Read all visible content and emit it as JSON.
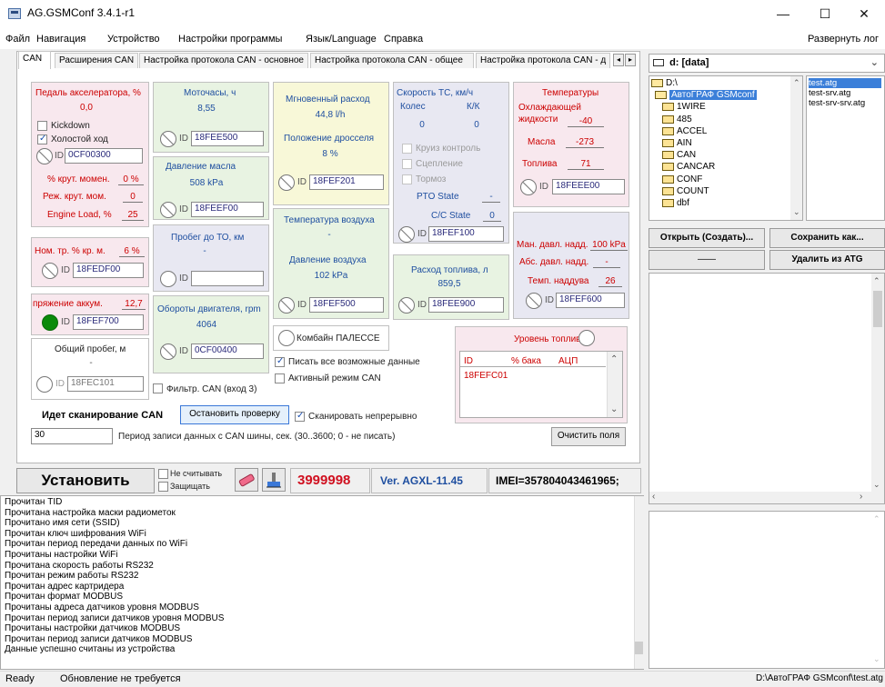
{
  "window": {
    "title": "AG.GSMConf 3.4.1-r1",
    "minimize": "—",
    "maximize": "☐",
    "close": "✕"
  },
  "menu": {
    "items": [
      "Файл",
      "Навигация",
      "Устройство",
      "Настройки программы",
      "Язык/Language",
      "Справка"
    ],
    "expand_log": "Развернуть лог"
  },
  "tabs": [
    "CAN",
    "Расширения CAN",
    "Настройка протокола CAN - основное",
    "Настройка протокола CAN - общее",
    "Настройка протокола CAN - д"
  ],
  "tab_scroll": {
    "left": "◂",
    "right": "▸"
  },
  "can": {
    "accel": {
      "label": "Педаль акселератора, %",
      "value": "0,0"
    },
    "kickdown": "Kickdown",
    "idle": "Холостой ход",
    "id_label": "ID",
    "pedal_id": "0CF00300",
    "torque_pct": {
      "label": "% крут. момен.",
      "value": "0 %"
    },
    "torque_mode": {
      "label": "Реж. крут. мом.",
      "value": "0"
    },
    "engine_load": {
      "label": "Engine Load, %",
      "value": "25"
    },
    "nom_torque": {
      "label": "Ном. тр. % кр. м.",
      "value": "6 %"
    },
    "nom_id": "18FEDF00",
    "battery": {
      "label": "пряжение аккум.",
      "value": "12,7"
    },
    "battery_id": "18FEF700",
    "odometer": {
      "label": "Общий пробег, м",
      "value": "-"
    },
    "odometer_id": "18FEC101",
    "motohours": {
      "label": "Моточасы, ч",
      "value": "8,55",
      "id": "18FEE500"
    },
    "oil_pressure": {
      "label": "Давление масла",
      "value": "508 kPa",
      "id": "18FEEF00"
    },
    "service": {
      "label": "Пробег до ТО, км",
      "value": "-",
      "id": ""
    },
    "rpm": {
      "label": "Обороты двигателя, rpm",
      "value": "4064",
      "id": "0CF00400"
    },
    "fuel_rate": {
      "label": "Мгновенный расход",
      "value": "44,8 l/h"
    },
    "throttle": {
      "label": "Положение дросселя",
      "value": "8 %",
      "id": "18FEF201"
    },
    "air_temp": {
      "label": "Температура воздуха",
      "value": "-"
    },
    "air_pressure": {
      "label": "Давление воздуха",
      "value": "102 kPa",
      "id": "18FEF500"
    },
    "speed": {
      "label": "Скорость ТС, км/ч",
      "col1": "Колес",
      "col2": "К/К",
      "v1": "0",
      "v2": "0"
    },
    "cruise": "Круиз контроль",
    "clutch": "Сцепление",
    "brake": "Тормоз",
    "pto": {
      "label": "PTO State",
      "value": "-"
    },
    "cc": {
      "label": "C/C State",
      "value": "0"
    },
    "speed_id": "18FEF100",
    "fuel_consumption": {
      "label": "Расход топлива, л",
      "value": "859,5",
      "id": "18FEE900"
    },
    "temps": {
      "label": "Температуры",
      "coolant_label": "Охлаждающей жидкости",
      "coolant": "-40",
      "oil_label": "Масла",
      "oil": "-273",
      "fuel_label": "Топлива",
      "fuel": "71",
      "id": "18FEEE00"
    },
    "boost": {
      "manifold_label": "Ман. давл. надд.",
      "manifold": "100 kPa",
      "abs_label": "Абс. давл. надд.",
      "abs": "-",
      "temp_label": "Темп. наддува",
      "temp": "26",
      "id": "18FEF600"
    },
    "palesse": "Комбайн ПАЛЕССЕ",
    "write_all": "Писать все возможные данные",
    "active_mode": "Активный режим CAN",
    "filter": "Фильтр. CAN (вход 3)",
    "fuel_level": {
      "label": "Уровень топлива",
      "columns": [
        "ID",
        "% бака",
        "АЦП"
      ],
      "rows": [
        [
          "18FEFC01",
          "",
          ""
        ]
      ]
    },
    "scan_status": "Идет сканирование CAN",
    "stop_check": "Остановить проверку",
    "scan_cont": "Сканировать непрерывно",
    "period_value": "30",
    "period_label": "Период записи данных с CAN шины, сек. (30..3600; 0 - не писать)",
    "clear_fields": "Очистить поля"
  },
  "bottom": {
    "install": "Установить",
    "no_read": "Не считывать",
    "protect": "Защищать",
    "serial": "3999998",
    "version": "Ver. AGXL-11.45",
    "imei": "IMEI=357804043461965;"
  },
  "files": {
    "drive": "d: [data]",
    "tree": [
      "D:\\",
      "АвтоГРАФ GSMconf",
      "1WIRE",
      "485",
      "ACCEL",
      "AIN",
      "CAN",
      "CANCAR",
      "CONF",
      "COUNT",
      "dbf"
    ],
    "list": [
      "test.atg",
      "test-srv.atg",
      "test-srv-srv.atg"
    ],
    "open_create": "Открыть (Создать)...",
    "save_as": "Сохранить как...",
    "dash": "——",
    "delete": "Удалить из ATG"
  },
  "log": [
    "Прочитан TID",
    "Прочитана настройка маски радиометок",
    "Прочитано имя сети (SSID)",
    "Прочитан ключ шифрования WiFi",
    "Прочитан период передачи данных по WiFi",
    "Прочитаны настройки WiFi",
    "Прочитана скорость работы RS232",
    "Прочитан режим работы RS232",
    "Прочитан адрес картридера",
    "Прочитан формат MODBUS",
    "Прочитаны адреса датчиков уровня MODBUS",
    "Прочитан период записи датчиков уровня MODBUS",
    "Прочитаны настройки датчиков MODBUS",
    "Прочитан период записи датчиков MODBUS",
    "Данные успешно считаны из устройства"
  ],
  "status": {
    "ready": "Ready",
    "update": "Обновление не требуется",
    "path": "D:\\АвтоГРАФ GSMconf\\test.atg"
  }
}
